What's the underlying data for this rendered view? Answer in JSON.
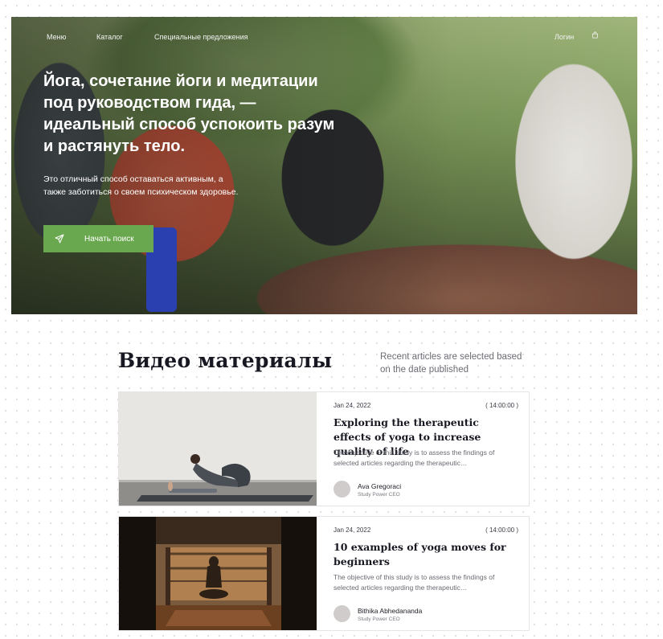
{
  "nav": {
    "items": [
      {
        "label": "Меню"
      },
      {
        "label": "Каталог"
      },
      {
        "label": "Специальные предложения"
      }
    ],
    "login": "Логин",
    "cart_icon": "shopping-bag-icon"
  },
  "hero": {
    "title": "Йога, сочетание йоги и медитации под руководством гида, — идеальный способ успокоить разум и растянуть тело.",
    "subtitle": "Это отличный способ оставаться активным, а также заботиться о своем психическом здоровье.",
    "cta_label": "Начать поиск",
    "cta_icon": "paper-plane-icon"
  },
  "section": {
    "title": "Видео материалы",
    "note": "Recent articles are selected based on the date published"
  },
  "articles": [
    {
      "date": "Jan 24, 2022",
      "time": "( 14:00:00 )",
      "title": "Exploring the therapeutic effects of yoga to increase quality of life",
      "description": "The objective of this study is to assess the findings of selected articles regarding the therapeutic…",
      "author": "Ava Gregoraci",
      "role": "Study Power CEO"
    },
    {
      "date": "Jan 24, 2022",
      "time": "( 14:00:00 )",
      "title": "10 examples of yoga moves for beginners",
      "description": "The objective of this study is to assess the findings of selected articles regarding the therapeutic…",
      "author": "Bithika Abhedananda",
      "role": "Study Power CEO"
    }
  ],
  "colors": {
    "accent": "#6aa84f",
    "heading": "#171821",
    "muted": "#6c6c74"
  }
}
